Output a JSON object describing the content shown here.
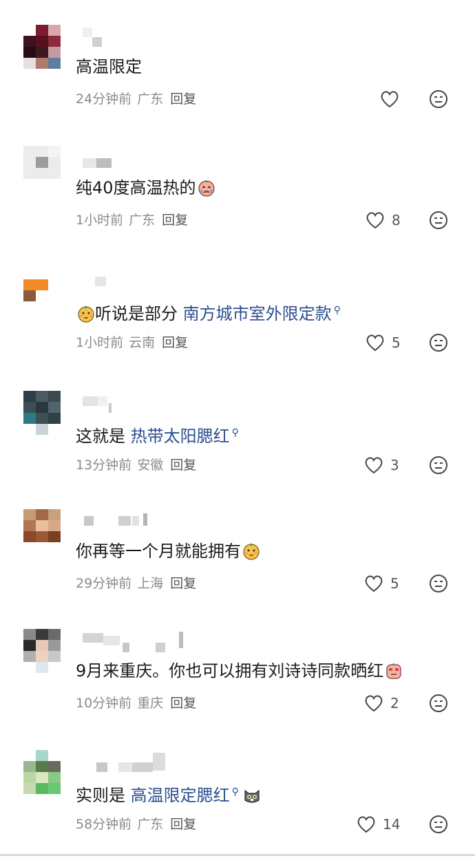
{
  "comments": [
    {
      "text_plain": "高温限定",
      "time": "24分钟前",
      "location": "广东",
      "reply_label": "回复",
      "likes": ""
    },
    {
      "text_plain": "纯40度高温热的",
      "time": "1小时前",
      "location": "广东",
      "reply_label": "回复",
      "likes": "8"
    },
    {
      "text_plain": "听说是部分",
      "link": "南方城市室外限定款",
      "time": "1小时前",
      "location": "云南",
      "reply_label": "回复",
      "likes": "5"
    },
    {
      "text_plain": "这就是",
      "link": "热带太阳腮红",
      "time": "13分钟前",
      "location": "安徽",
      "reply_label": "回复",
      "likes": "3"
    },
    {
      "text_plain": "你再等一个月就能拥有",
      "time": "29分钟前",
      "location": "上海",
      "reply_label": "回复",
      "likes": "5"
    },
    {
      "text_plain": "9月来重庆。你也可以拥有刘诗诗同款晒红",
      "time": "10分钟前",
      "location": "重庆",
      "reply_label": "回复",
      "likes": "2"
    },
    {
      "text_plain": "实则是",
      "link": "高温限定腮红",
      "time": "58分钟前",
      "location": "广东",
      "reply_label": "回复",
      "likes": "14"
    }
  ],
  "icons": {
    "like": "heart-outline-icon",
    "react": "neutral-face-icon",
    "search": "search-small-icon"
  },
  "colors": {
    "link": "#2b4e8f",
    "meta": "#8a8a8a",
    "text": "#1b1b1b"
  }
}
